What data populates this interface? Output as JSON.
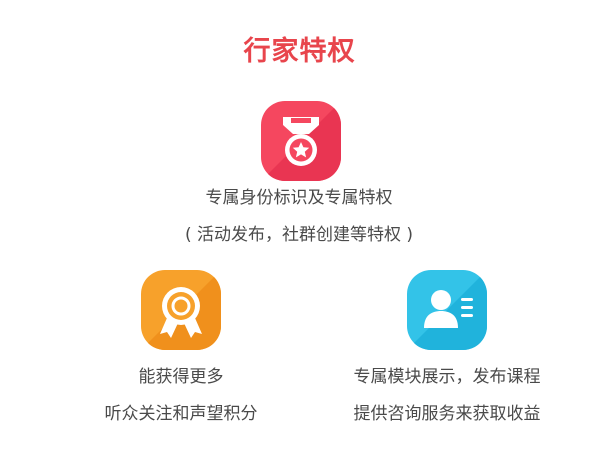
{
  "page": {
    "title": "行家特权",
    "title_color": "#e8454c"
  },
  "features": [
    {
      "icon": "medal-star-icon",
      "color": "#f5475f",
      "lines": [
        "专属身份标识及专属特权",
        "( 活动发布，社群创建等特权 )"
      ]
    },
    {
      "icon": "award-ribbon-icon",
      "color": "#f7a12b",
      "lines": [
        "能获得更多",
        "听众关注和声望积分"
      ]
    },
    {
      "icon": "profile-card-icon",
      "color": "#33c3e8",
      "lines": [
        "专属模块展示，发布课程",
        "提供咨询服务来获取收益"
      ]
    }
  ]
}
